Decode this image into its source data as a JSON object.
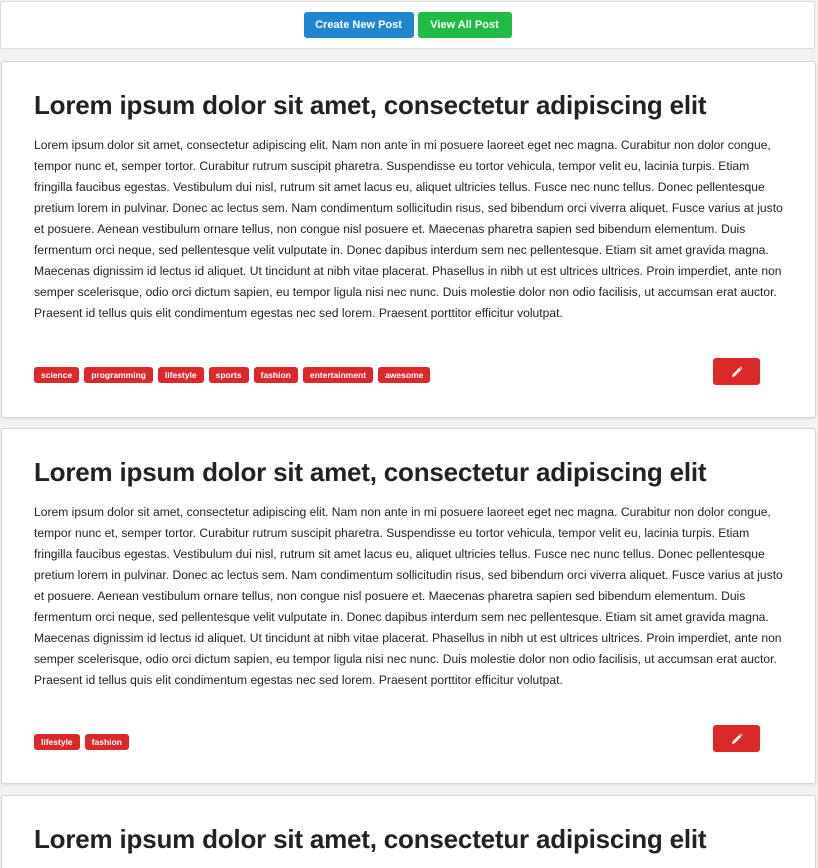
{
  "toolbar": {
    "create_label": "Create New Post",
    "view_all_label": "View All Post",
    "create_color": "#2185d0",
    "view_all_color": "#21ba45"
  },
  "posts": [
    {
      "title": "Lorem ipsum dolor sit amet, consectetur adipiscing elit",
      "body": "Lorem ipsum dolor sit amet, consectetur adipiscing elit. Nam non ante in mi posuere laoreet eget nec magna. Curabitur non dolor congue, tempor nunc et, semper tortor. Curabitur rutrum suscipit pharetra. Suspendisse eu tortor vehicula, tempor velit eu, lacinia turpis. Etiam fringilla faucibus egestas. Vestibulum dui nisl, rutrum sit amet lacus eu, aliquet ultricies tellus. Fusce nec nunc tellus. Donec pellentesque pretium lorem in pulvinar. Donec ac lectus sem. Nam condimentum sollicitudin risus, sed bibendum orci viverra aliquet. Fusce varius at justo et posuere. Aenean vestibulum ornare tellus, non congue nisl posuere et. Maecenas pharetra sapien sed bibendum elementum. Duis fermentum orci neque, sed pellentesque velit vulputate in. Donec dapibus interdum sem nec pellentesque. Etiam sit amet gravida magna. Maecenas dignissim id lectus id aliquet. Ut tincidunt at nibh vitae placerat. Phasellus in nibh ut est ultrices ultrices. Proin imperdiet, ante non semper scelerisque, odio orci dictum sapien, eu tempor ligula nisi nec nunc. Duis molestie dolor non odio facilisis, ut accumsan erat auctor. Praesent id tellus quis elit condimentum egestas nec sed lorem. Praesent porttitor efficitur volutpat.",
      "tags": [
        "science",
        "programming",
        "lifestyle",
        "sports",
        "fashion",
        "entertainment",
        "awesome"
      ],
      "edit_icon": "pencil-icon"
    },
    {
      "title": "Lorem ipsum dolor sit amet, consectetur adipiscing elit",
      "body": "Lorem ipsum dolor sit amet, consectetur adipiscing elit. Nam non ante in mi posuere laoreet eget nec magna. Curabitur non dolor congue, tempor nunc et, semper tortor. Curabitur rutrum suscipit pharetra. Suspendisse eu tortor vehicula, tempor velit eu, lacinia turpis. Etiam fringilla faucibus egestas. Vestibulum dui nisl, rutrum sit amet lacus eu, aliquet ultricies tellus. Fusce nec nunc tellus. Donec pellentesque pretium lorem in pulvinar. Donec ac lectus sem. Nam condimentum sollicitudin risus, sed bibendum orci viverra aliquet. Fusce varius at justo et posuere. Aenean vestibulum ornare tellus, non congue nisl posuere et. Maecenas pharetra sapien sed bibendum elementum. Duis fermentum orci neque, sed pellentesque velit vulputate in. Donec dapibus interdum sem nec pellentesque. Etiam sit amet gravida magna. Maecenas dignissim id lectus id aliquet. Ut tincidunt at nibh vitae placerat. Phasellus in nibh ut est ultrices ultrices. Proin imperdiet, ante non semper scelerisque, odio orci dictum sapien, eu tempor ligula nisi nec nunc. Duis molestie dolor non odio facilisis, ut accumsan erat auctor. Praesent id tellus quis elit condimentum egestas nec sed lorem. Praesent porttitor efficitur volutpat.",
      "tags": [
        "lifestyle",
        "fashion"
      ],
      "edit_icon": "pencil-icon"
    },
    {
      "title": "Lorem ipsum dolor sit amet, consectetur adipiscing elit"
    }
  ],
  "colors": {
    "tag": "#db2828",
    "edit_button": "#db2828"
  }
}
